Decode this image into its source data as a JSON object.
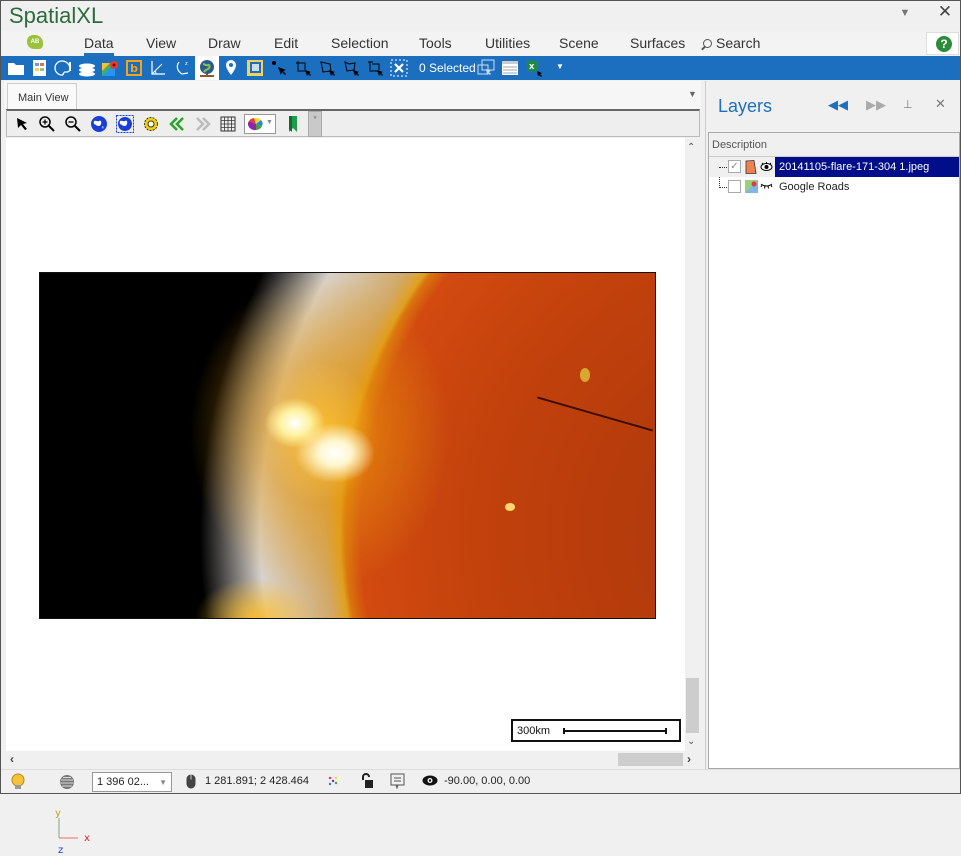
{
  "app": {
    "title": "SpatialXL",
    "window_dropdown_icon": "caret-down-icon",
    "close_icon": "close-icon"
  },
  "ribbon": {
    "logo_label": "AB",
    "tabs": [
      {
        "label": "Data",
        "active": true
      },
      {
        "label": "View",
        "active": false
      },
      {
        "label": "Draw",
        "active": false
      },
      {
        "label": "Edit",
        "active": false
      },
      {
        "label": "Selection",
        "active": false
      },
      {
        "label": "Tools",
        "active": false
      },
      {
        "label": "Utilities",
        "active": false
      },
      {
        "label": "Scene",
        "active": false
      },
      {
        "label": "Surfaces",
        "active": false
      }
    ],
    "search_label": "Search",
    "help_label": "?"
  },
  "toolbar": {
    "icons": [
      "open-folder-icon",
      "data-sheet-icon",
      "palette-icon",
      "layers-stack-icon",
      "google-maps-icon",
      "bing-icon",
      "measure-angle-icon",
      "coordinate-system-icon",
      "globe-icon",
      "map-pin-icon",
      "frame-icon",
      "select-point-icon",
      "select-add-icon",
      "select-polygon-icon",
      "select-remove-icon",
      "clear-selection-icon"
    ],
    "selected_count": "0 Selected",
    "trailing_icons": [
      "zoom-to-selection-icon",
      "attribute-table-icon",
      "excel-export-icon",
      "more-dropdown-icon"
    ]
  },
  "main_view": {
    "tab_label": "Main View",
    "map_tools": [
      "pointer-icon",
      "zoom-in-icon",
      "zoom-out-icon",
      "full-extent-icon",
      "zoom-extent-icon",
      "settings-gear-icon",
      "previous-extent-icon",
      "next-extent-icon",
      "grid-icon",
      "legend-dropdown-icon",
      "bookmark-icon"
    ],
    "overflow_label": "*",
    "raster_layer": "20141105-flare-171-304 1.jpeg",
    "axis": {
      "y": "y",
      "x": "x",
      "z": "z"
    },
    "scalebar_label": "300km"
  },
  "layers_panel": {
    "title": "Layers",
    "column_header": "Description",
    "layers": [
      {
        "name": "20141105-flare-171-304 1.jpeg",
        "checked": true,
        "visible": true,
        "selected": true,
        "type_icon": "raster-image-icon"
      },
      {
        "name": "Google Roads",
        "checked": false,
        "visible": false,
        "selected": false,
        "type_icon": "google-map-tile-icon"
      }
    ]
  },
  "statusbar": {
    "scale_value": "1 396 02...",
    "cursor_coords": "1 281.891; 2 428.464",
    "camera_rotation": "-90.00, 0.00, 0.00"
  },
  "colors": {
    "accent_blue": "#1c6fbf",
    "title_green": "#2d6b3c",
    "selection_navy": "#000e8a"
  }
}
